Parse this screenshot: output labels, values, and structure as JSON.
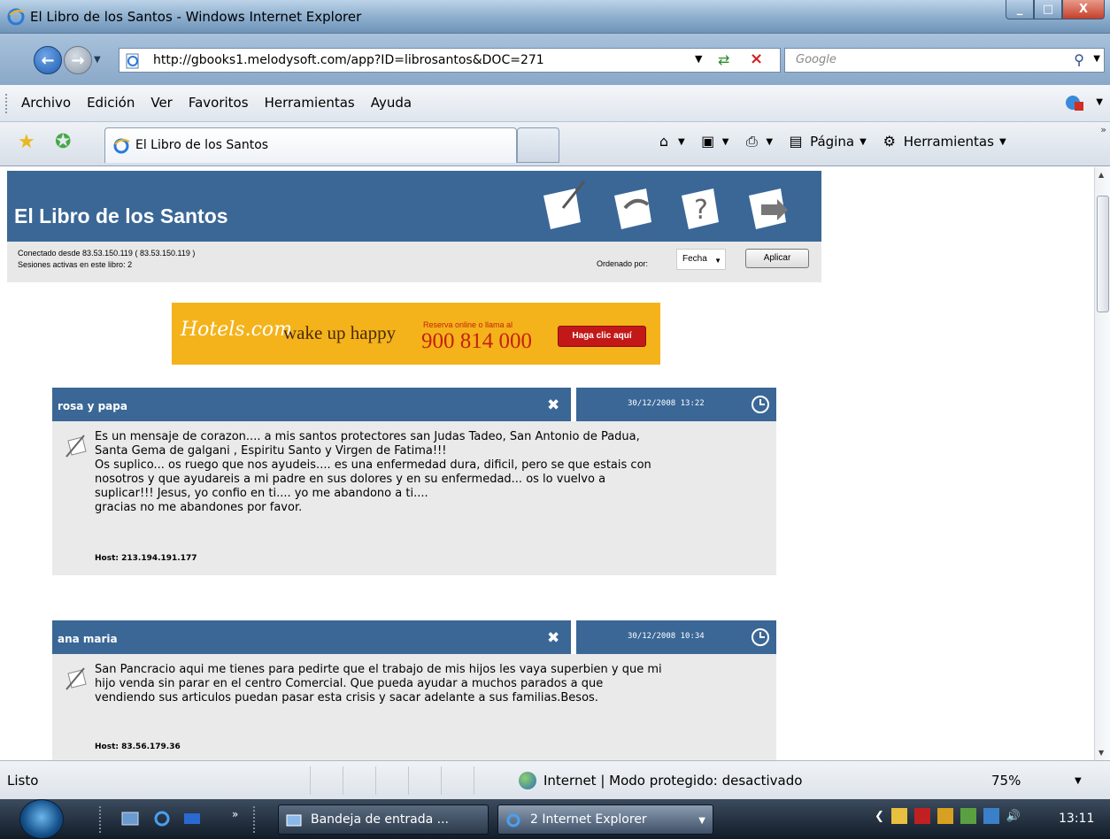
{
  "window": {
    "title": "El Libro de los Santos - Windows Internet Explorer",
    "buttons": [
      "_",
      "□",
      "X"
    ]
  },
  "address": {
    "url": "http://gbooks1.melodysoft.com/app?ID=librosantos&DOC=271",
    "search_placeholder": "Google"
  },
  "menu": {
    "items": [
      "Archivo",
      "Edición",
      "Ver",
      "Favoritos",
      "Herramientas",
      "Ayuda"
    ]
  },
  "tabs": {
    "active_label": "El Libro de los Santos",
    "cmd": {
      "pagina_label": "Página",
      "herramientas_label": "Herramientas"
    }
  },
  "page": {
    "site_title": "El Libro de los Santos",
    "connected": "Conectado desde 83.53.150.119 ( 83.53.150.119 )",
    "sessions": "Sesiones activas en este libro: 2",
    "order_label": "Ordenado por:",
    "order_value": "Fecha",
    "apply_label": "Aplicar",
    "ad": {
      "brand": "Hotels.com",
      "slogan": "wake up happy",
      "reserva": "Reserva online o llama al",
      "phone": "900 814 000",
      "cta": "Haga clic aquí"
    },
    "entries": [
      {
        "name": "rosa y papa",
        "date": "30/12/2008  13:22",
        "message": "Es un mensaje de corazon.... a mis santos protectores san Judas Tadeo, San Antonio de Padua,\nSanta Gema de galgani , Espiritu Santo y Virgen de Fatima!!!\nOs suplico... os ruego que nos ayudeis.... es una enfermedad dura, dificil, pero se que estais con\nnosotros y que ayudareis a mi padre en sus dolores y en su enfermedad... os lo vuelvo a\nsuplicar!!! Jesus, yo confio en ti.... yo me abandono a ti....\ngracias no me abandones por favor.",
        "host": "Host: 213.194.191.177"
      },
      {
        "name": "ana maria",
        "date": "30/12/2008  10:34",
        "message": "San Pancracio aqui me tienes para pedirte que el trabajo de mis hijos les vaya superbien y que mi\nhijo venda sin parar en el centro Comercial. Que pueda ayudar a muchos parados a que\nvendiendo sus articulos puedan pasar esta crisis y sacar adelante a sus familias.Besos.",
        "host": "Host: 83.56.179.36"
      }
    ]
  },
  "status": {
    "text": "Listo",
    "zone": "Internet | Modo protegido: desactivado",
    "zoom": "75%"
  },
  "taskbar": {
    "task1": "Bandeja de entrada ...",
    "task2": "2 Internet Explorer",
    "time": "13:11"
  },
  "colors": {
    "header_blue": "#3a6796",
    "entry_body": "#eaeaea",
    "ad_orange": "#f4b31a"
  }
}
